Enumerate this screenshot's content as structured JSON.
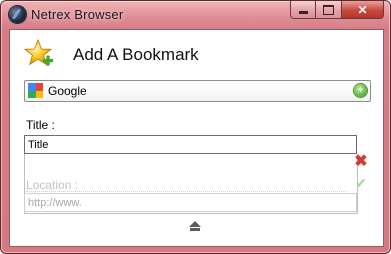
{
  "window": {
    "title": "Netrex Browser",
    "icon": "netrex-globe-icon",
    "controls": {
      "minimize": "minimize-icon",
      "maximize": "maximize-icon",
      "close_label": "✕"
    }
  },
  "dialog": {
    "heading": "Add A Bookmark",
    "heading_icon": "bookmark-star-add-icon",
    "search_engine": {
      "selected": "Google",
      "icon": "google-icon",
      "action_icon": "green-add-icon"
    },
    "title_field": {
      "label": "Title :",
      "value": "Title"
    },
    "location_field": {
      "label": "Location :",
      "placeholder": "http://www."
    },
    "buttons": {
      "cancel_icon": "red-x-icon",
      "confirm_icon": "green-check-icon",
      "collapse_icon": "eject-up-icon"
    }
  },
  "colors": {
    "frame": "#d77c86",
    "close_button": "#c9483c",
    "cancel_red": "#d33a36",
    "confirm_green": "#a9d59a"
  }
}
